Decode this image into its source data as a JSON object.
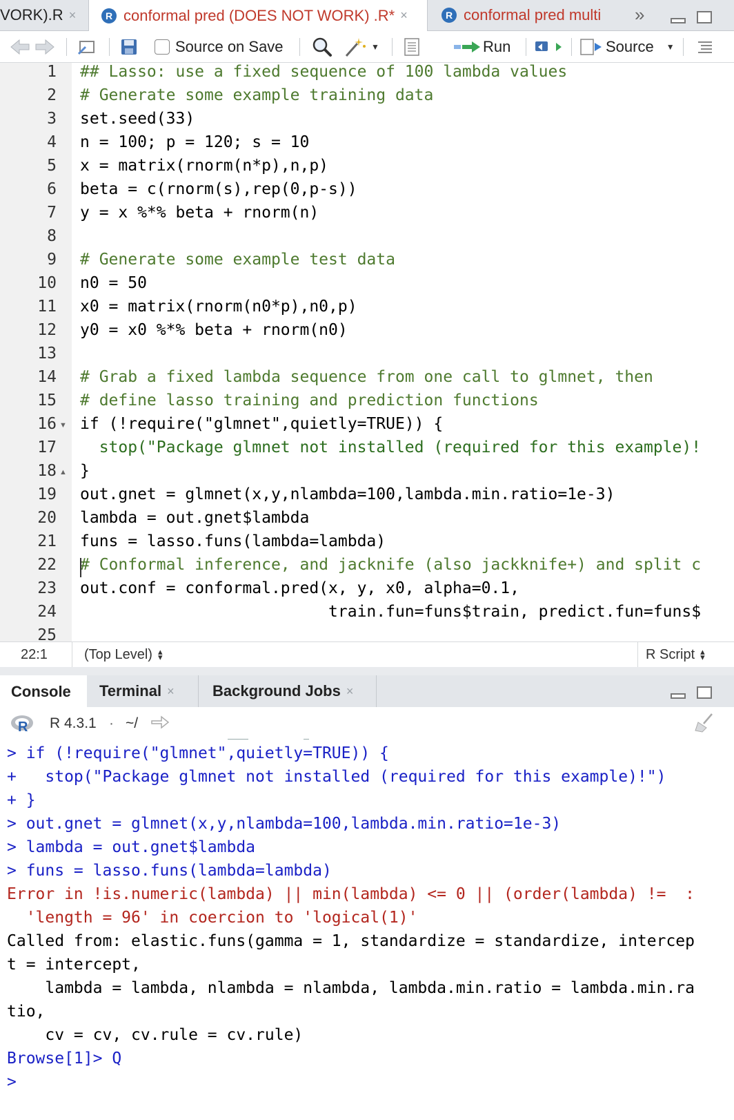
{
  "tabs": [
    {
      "label": "VORK).R",
      "active": false
    },
    {
      "label": "conformal pred (DOES NOT WORK) .R*",
      "active": true
    },
    {
      "label": "conformal pred multi",
      "active": false
    }
  ],
  "tab_close_glyph": "×",
  "tab_overflow_glyph": "»",
  "toolbar": {
    "source_on_save": "Source on Save",
    "run": "Run",
    "source": "Source"
  },
  "editor": {
    "line_numbers": [
      "1",
      "2",
      "3",
      "4",
      "5",
      "6",
      "7",
      "8",
      "9",
      "10",
      "11",
      "12",
      "13",
      "14",
      "15",
      "16",
      "17",
      "18",
      "19",
      "20",
      "21",
      "22",
      "23",
      "24",
      "25"
    ],
    "lines": [
      "## Lasso: use a fixed sequence of 100 lambda values",
      "# Generate some example training data",
      "set.seed(33)",
      "n = 100; p = 120; s = 10",
      "x = matrix(rnorm(n*p),n,p)",
      "beta = c(rnorm(s),rep(0,p-s))",
      "y = x %*% beta + rnorm(n)",
      "",
      "# Generate some example test data",
      "n0 = 50",
      "x0 = matrix(rnorm(n0*p),n0,p)",
      "y0 = x0 %*% beta + rnorm(n0)",
      "",
      "# Grab a fixed lambda sequence from one call to glmnet, then",
      "# define lasso training and prediction functions",
      "if (!require(\"glmnet\",quietly=TRUE)) {",
      "  stop(\"Package glmnet not installed (required for this example)!",
      "}",
      "out.gnet = glmnet(x,y,nlambda=100,lambda.min.ratio=1e-3)",
      "lambda = out.gnet$lambda",
      "funs = lasso.funs(lambda=lambda)",
      "# Conformal inference, and jacknife (also jackknife+) and split c",
      "out.conf = conformal.pred(x, y, x0, alpha=0.1,",
      "                          train.fun=funs$train, predict.fun=funs$",
      ""
    ]
  },
  "status": {
    "position": "22:1",
    "scope": "(Top Level)",
    "filetype": "R Script"
  },
  "console_tabs": [
    {
      "label": "Console",
      "active": true
    },
    {
      "label": "Terminal",
      "active": false
    },
    {
      "label": "Background Jobs",
      "active": false
    }
  ],
  "console_header": {
    "version": "R 4.3.1",
    "path": "~/"
  },
  "console_lines": [
    {
      "text": "> if (!require(\"glmnet\",quietly=TRUE)) {",
      "kind": "input"
    },
    {
      "text": "+   stop(\"Package glmnet not installed (required for this example)!\")",
      "kind": "input"
    },
    {
      "text": "+ }",
      "kind": "input"
    },
    {
      "text": "> out.gnet = glmnet(x,y,nlambda=100,lambda.min.ratio=1e-3)",
      "kind": "input"
    },
    {
      "text": "> lambda = out.gnet$lambda",
      "kind": "input"
    },
    {
      "text": "> funs = lasso.funs(lambda=lambda)",
      "kind": "input"
    },
    {
      "text": "Error in !is.numeric(lambda) || min(lambda) <= 0 || (order(lambda) !=  :",
      "kind": "error"
    },
    {
      "text": "  'length = 96' in coercion to 'logical(1)'",
      "kind": "error"
    },
    {
      "text": "Called from: elastic.funs(gamma = 1, standardize = standardize, intercep",
      "kind": "output"
    },
    {
      "text": "t = intercept,",
      "kind": "output"
    },
    {
      "text": "    lambda = lambda, nlambda = nlambda, lambda.min.ratio = lambda.min.ra",
      "kind": "output"
    },
    {
      "text": "tio,",
      "kind": "output"
    },
    {
      "text": "    cv = cv, cv.rule = cv.rule)",
      "kind": "output"
    },
    {
      "text": "Browse[1]> Q",
      "kind": "input"
    },
    {
      "text": ">",
      "kind": "input"
    }
  ],
  "colors": {
    "comment": "#4e7a2f",
    "number": "#1a21c6",
    "string": "#2d6e1f",
    "error": "#b3261e",
    "console_input": "#1a21c6"
  }
}
